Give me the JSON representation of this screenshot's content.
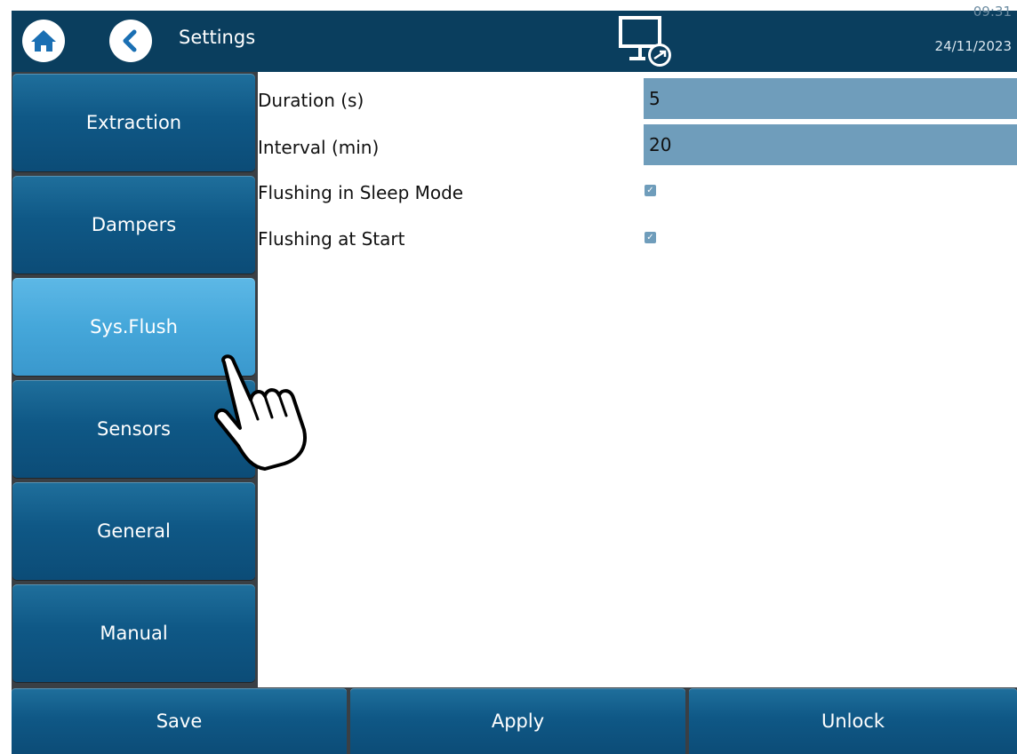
{
  "header": {
    "title": "Settings",
    "time": "09:31",
    "date": "24/11/2023",
    "icons": {
      "home": "home-icon",
      "back": "back-arrow-icon",
      "remote": "remote-desktop-icon"
    }
  },
  "sidebar": {
    "items": [
      {
        "label": "Extraction",
        "active": false
      },
      {
        "label": "Dampers",
        "active": false
      },
      {
        "label": "Sys.Flush",
        "active": true
      },
      {
        "label": "Sensors",
        "active": false
      },
      {
        "label": "General",
        "active": false
      },
      {
        "label": "Manual",
        "active": false
      }
    ]
  },
  "form": {
    "duration": {
      "label": "Duration (s)",
      "value": "5"
    },
    "interval": {
      "label": "Interval (min)",
      "value": "20"
    },
    "sleep_flush": {
      "label": "Flushing in Sleep Mode",
      "checked": true
    },
    "start_flush": {
      "label": "Flushing at Start",
      "checked": true
    }
  },
  "footer": {
    "save_label": "Save",
    "apply_label": "Apply",
    "unlock_label": "Unlock"
  },
  "colors": {
    "header_bg": "#0a3e5e",
    "button_blue": "#0f5886",
    "active_button": "#45a7da",
    "input_bg": "#6f9dbb"
  }
}
